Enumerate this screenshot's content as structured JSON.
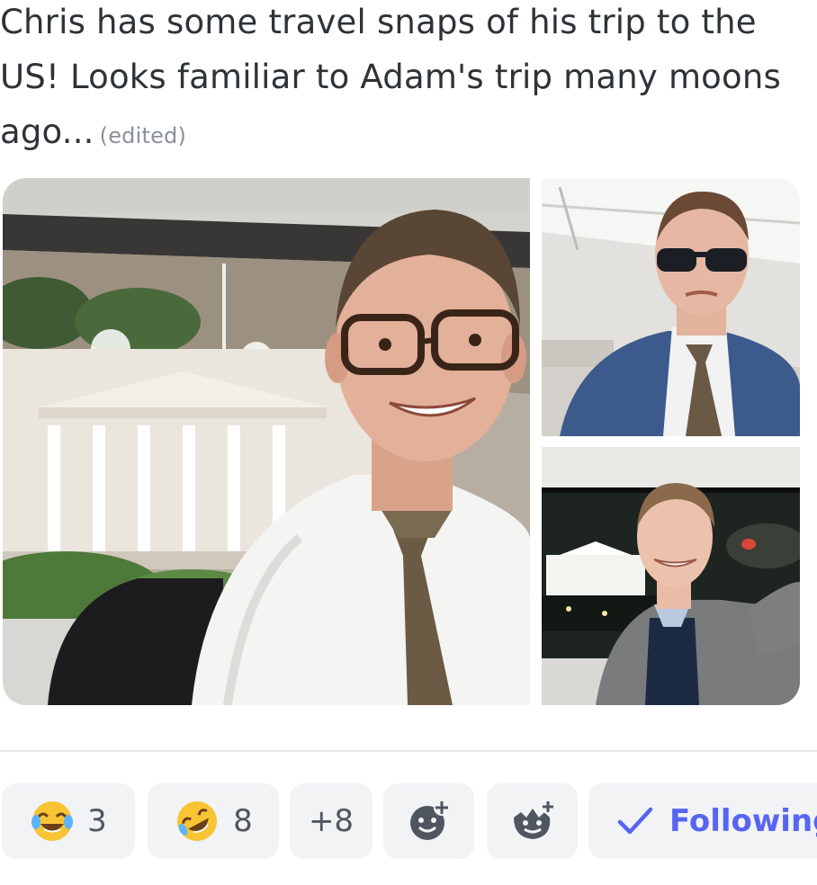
{
  "message": {
    "text": "Chris has some travel snaps of his trip to the US! Looks familiar to Adam's trip many moons ago...",
    "edited_label": "(edited)"
  },
  "attachments": [
    {
      "icon": "photo-white-house-day-selfie"
    },
    {
      "icon": "photo-sunglasses-selfie"
    },
    {
      "icon": "photo-white-house-night-selfie"
    }
  ],
  "reactions": [
    {
      "icon": "face-with-tears-of-joy-emoji",
      "count": "3"
    },
    {
      "icon": "rolling-on-floor-laughing-emoji",
      "count": "8"
    }
  ],
  "more_reactions_label": "+8",
  "add_reaction_icon": "add-reaction-icon",
  "add_super_reaction_icon": "add-super-reaction-icon",
  "follow": {
    "label": "Following",
    "icon": "checkmark-icon"
  },
  "colors": {
    "text": "#2e3338",
    "muted": "#8a9099",
    "reaction_bg": "#f2f3f5",
    "accent": "#5865f2"
  }
}
